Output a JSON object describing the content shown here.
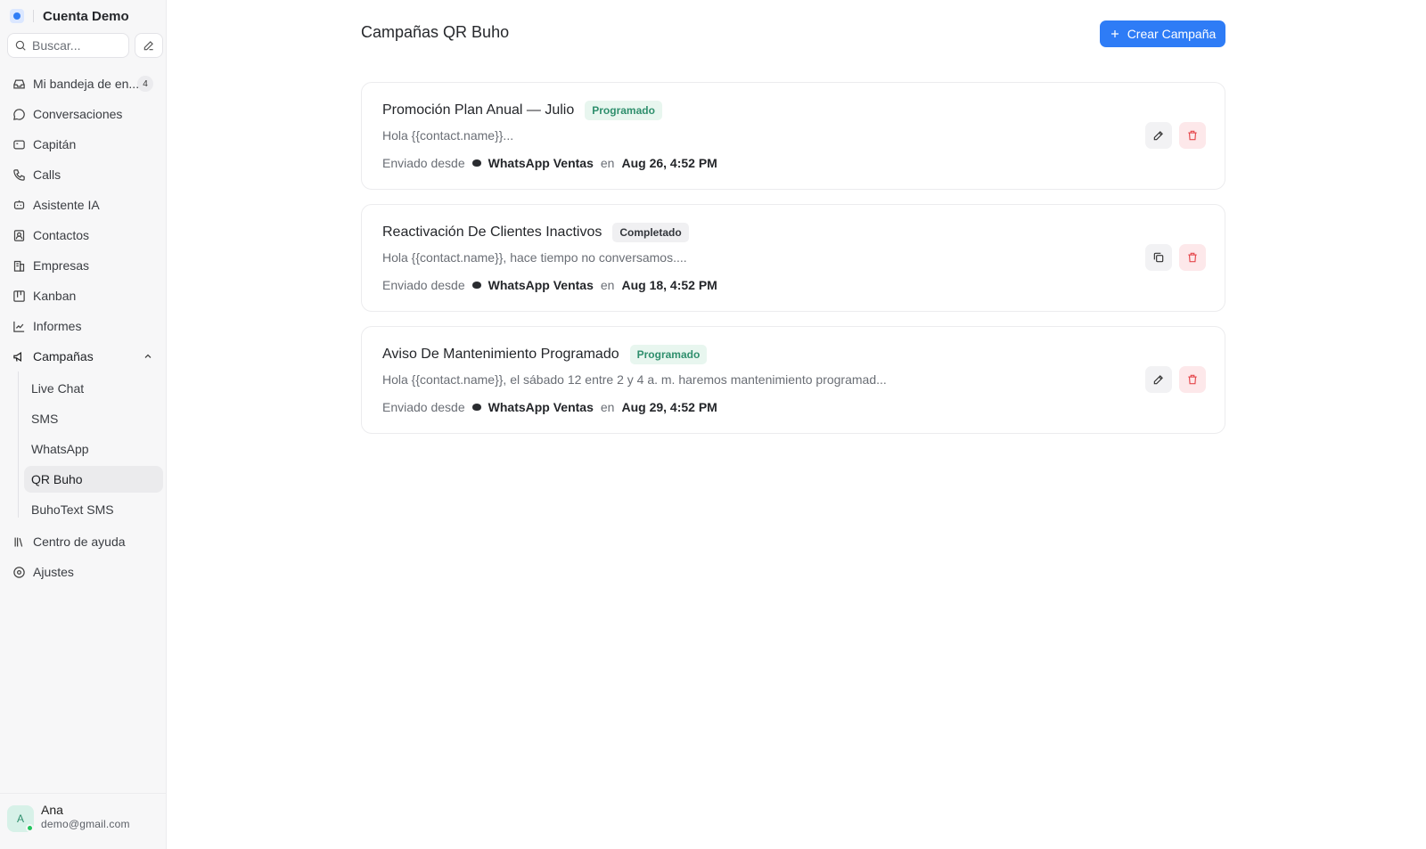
{
  "sidebar": {
    "account_name": "Cuenta Demo",
    "search_placeholder": "Buscar...",
    "items": [
      {
        "label": "Mi bandeja de en...",
        "icon": "inbox-icon",
        "count": "4"
      },
      {
        "label": "Conversaciones",
        "icon": "chat-bubble-icon"
      },
      {
        "label": "Capitán",
        "icon": "captain-icon"
      },
      {
        "label": "Calls",
        "icon": "phone-icon"
      },
      {
        "label": "Asistente IA",
        "icon": "bot-icon"
      },
      {
        "label": "Contactos",
        "icon": "contacts-icon"
      },
      {
        "label": "Empresas",
        "icon": "building-icon"
      },
      {
        "label": "Kanban",
        "icon": "kanban-icon"
      },
      {
        "label": "Informes",
        "icon": "chart-line-icon"
      },
      {
        "label": "Campañas",
        "icon": "megaphone-icon",
        "expanded": true
      },
      {
        "label": "Centro de ayuda",
        "icon": "library-icon"
      },
      {
        "label": "Ajustes",
        "icon": "settings-icon"
      }
    ],
    "campaign_subitems": [
      {
        "label": "Live Chat"
      },
      {
        "label": "SMS"
      },
      {
        "label": "WhatsApp"
      },
      {
        "label": "QR Buho",
        "active": true
      },
      {
        "label": "BuhoText SMS"
      }
    ],
    "user": {
      "initial": "A",
      "name": "Ana",
      "email": "demo@gmail.com",
      "status_color": "#22c55e"
    }
  },
  "main": {
    "title": "Campañas QR Buho",
    "create_button": "Crear Campaña",
    "accent_color": "#2e7cf6",
    "campaigns": [
      {
        "title": "Promoción Plan Anual — Julio",
        "status": "Programado",
        "message": "Hola {{contact.name}}...",
        "sent_from_label": "Enviado desde",
        "inbox": "WhatsApp Ventas",
        "on_label": "en",
        "date": "Aug 26, 4:52 PM",
        "action": "edit"
      },
      {
        "title": "Reactivación De Clientes Inactivos",
        "status": "Completado",
        "message": "Hola {{contact.name}}, hace tiempo no conversamos....",
        "sent_from_label": "Enviado desde",
        "inbox": "WhatsApp Ventas",
        "on_label": "en",
        "date": "Aug 18, 4:52 PM",
        "action": "duplicate"
      },
      {
        "title": "Aviso De Mantenimiento Programado",
        "status": "Programado",
        "message": "Hola {{contact.name}}, el sábado 12 entre 2 y 4 a. m. haremos mantenimiento programad...",
        "sent_from_label": "Enviado desde",
        "inbox": "WhatsApp Ventas",
        "on_label": "en",
        "date": "Aug 29, 4:52 PM",
        "action": "edit"
      }
    ]
  }
}
